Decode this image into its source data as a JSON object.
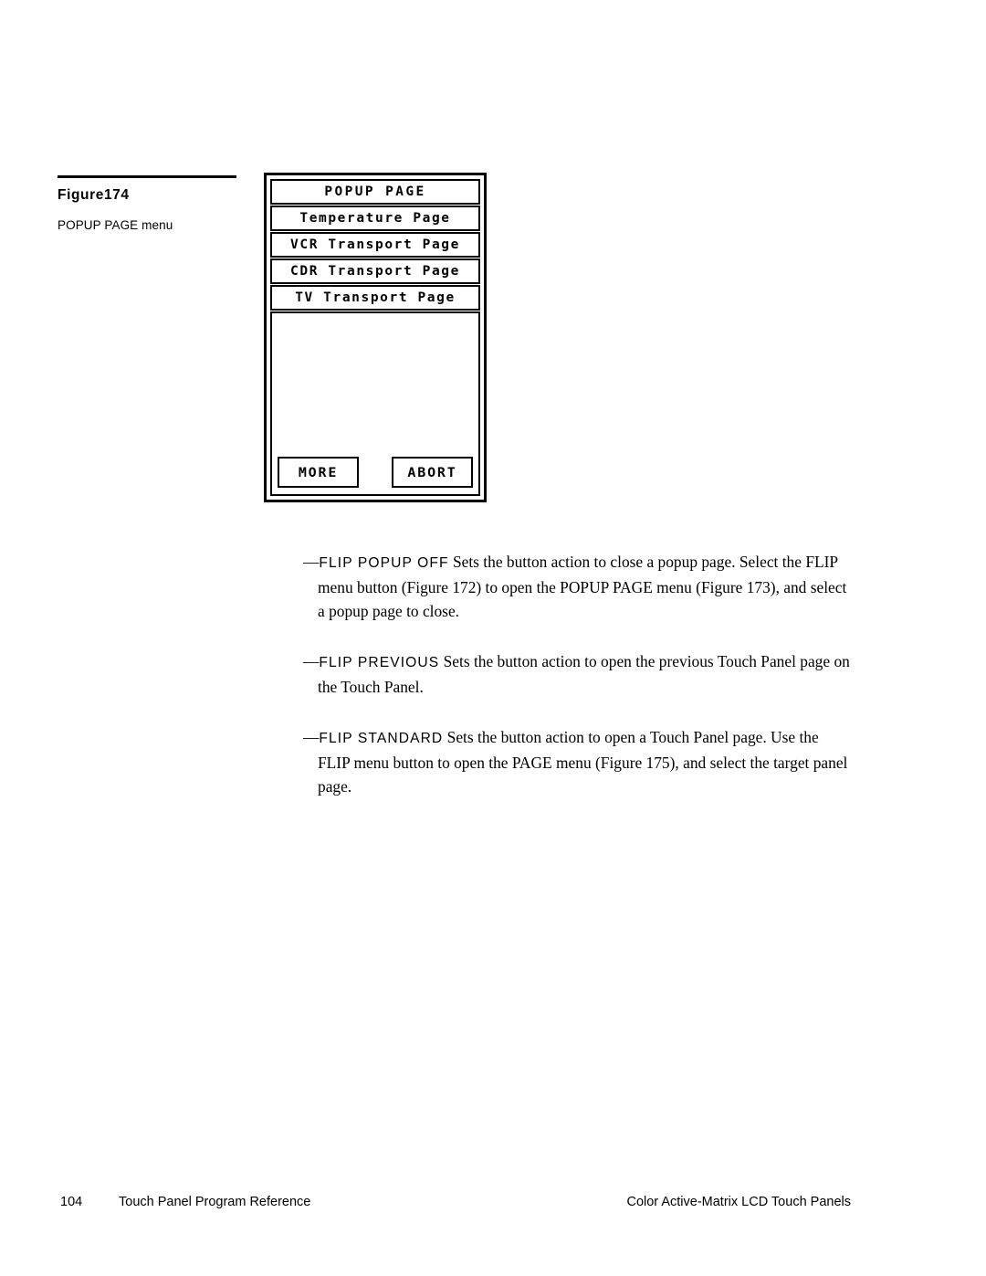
{
  "figure": {
    "number": "Figure174",
    "description": "POPUP PAGE menu"
  },
  "touch_panel": {
    "title": "POPUP PAGE",
    "menu_items": [
      "Temperature Page",
      "VCR Transport Page",
      "CDR Transport Page",
      "TV Transport Page"
    ],
    "buttons": {
      "more": "MORE",
      "abort": "ABORT"
    }
  },
  "body": {
    "paragraphs": [
      {
        "dash": "—",
        "term": "FLIP POPUP OFF",
        "text": " Sets the button action to close a popup page. Select the FLIP menu button (Figure 172) to open the POPUP PAGE menu (Figure 173), and select a popup page to close."
      },
      {
        "dash": "—",
        "term": "FLIP PREVIOUS",
        "text": " Sets the button action to open the previous Touch Panel page on the Touch Panel."
      },
      {
        "dash": "—",
        "term": "FLIP STANDARD",
        "text": " Sets the button action to open a Touch Panel page. Use the FLIP menu button to open the PAGE menu (Figure 175), and select the target panel page."
      }
    ]
  },
  "footer": {
    "page_number": "104",
    "left_title": "Touch Panel Program Reference",
    "right_title": "Color Active-Matrix LCD Touch Panels"
  }
}
